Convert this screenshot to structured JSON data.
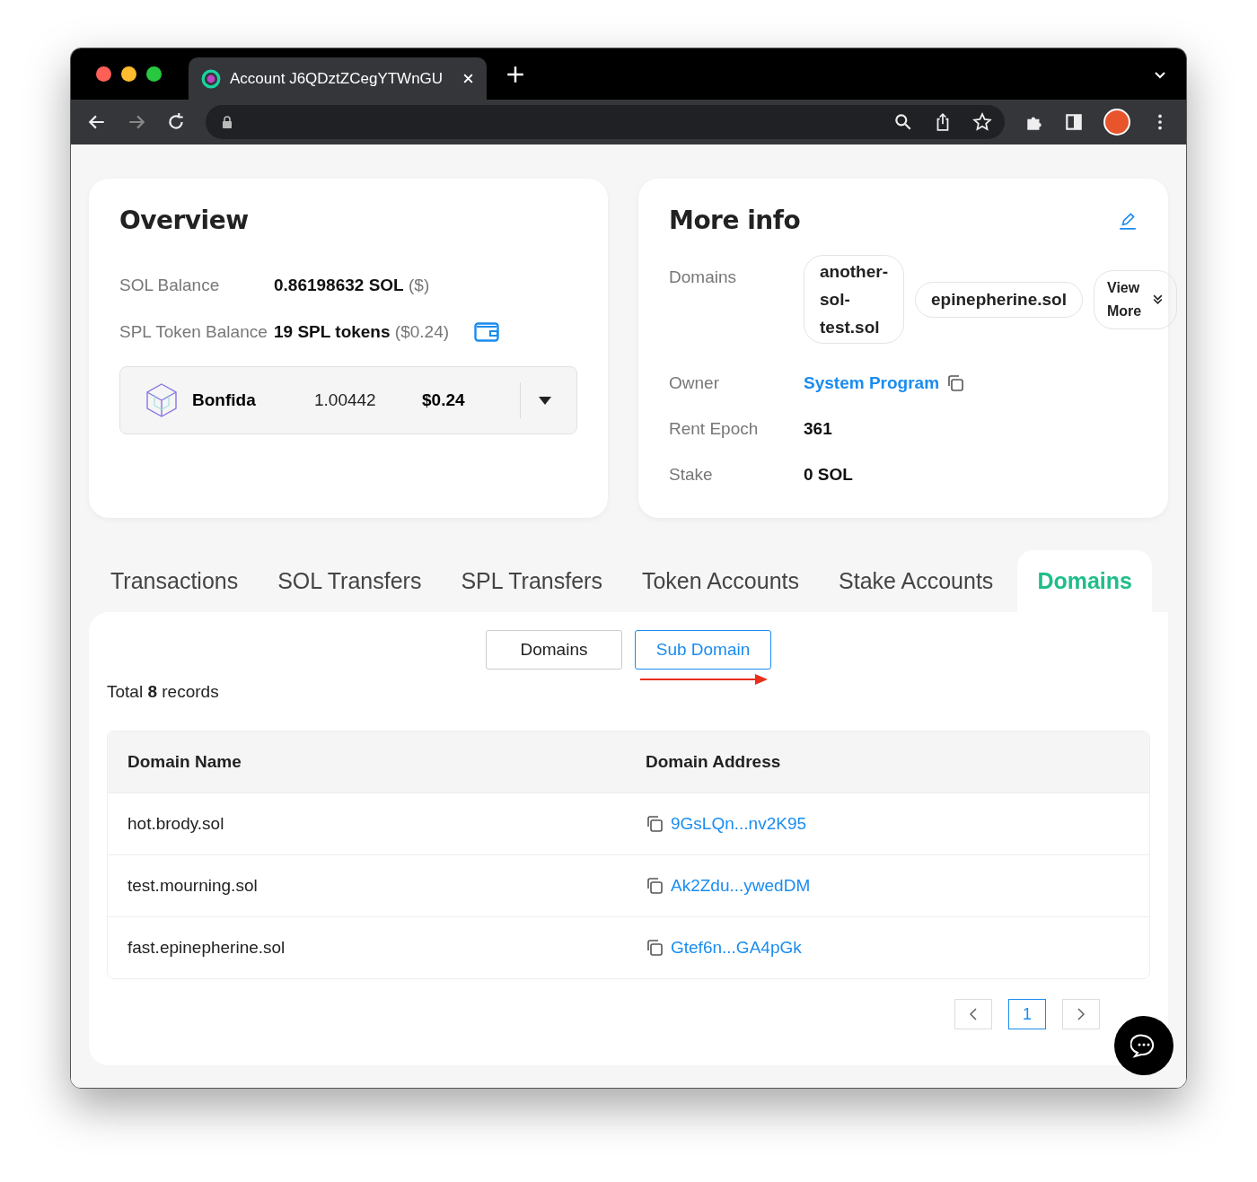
{
  "browser": {
    "tab_title": "Account J6QDztZCegYTWnGU"
  },
  "overview": {
    "title": "Overview",
    "rows": [
      {
        "label": "SOL Balance",
        "value": "0.86198632 SOL",
        "note": "($)",
        "wallet": false
      },
      {
        "label": "SPL Token Balance",
        "value": "19 SPL tokens",
        "note": "($0.24)",
        "wallet": true
      }
    ],
    "token": {
      "name": "Bonfida",
      "amount": "1.00442",
      "usd": "$0.24"
    }
  },
  "more_info": {
    "title": "More info",
    "domains_label": "Domains",
    "domains": [
      "another-sol-test.sol",
      "epinepherine.sol"
    ],
    "view_more": "View More",
    "rows": [
      {
        "label": "Owner",
        "value": "System Program",
        "kind": "link"
      },
      {
        "label": "Rent Epoch",
        "value": "361",
        "kind": "text"
      },
      {
        "label": "Stake",
        "value": "0 SOL",
        "kind": "text"
      }
    ]
  },
  "tabs": [
    {
      "label": "Transactions",
      "selected": false
    },
    {
      "label": "SOL Transfers",
      "selected": false
    },
    {
      "label": "SPL Transfers",
      "selected": false
    },
    {
      "label": "Token Accounts",
      "selected": false
    },
    {
      "label": "Stake Accounts",
      "selected": false
    },
    {
      "label": "Domains",
      "selected": true
    }
  ],
  "segments": [
    {
      "label": "Domains",
      "selected": false
    },
    {
      "label": "Sub Domain",
      "selected": true
    }
  ],
  "total": "Total **8** records",
  "table": {
    "columns": [
      "Domain Name",
      "Domain Address"
    ],
    "rows": [
      {
        "name": "hot.brody.sol",
        "address": "9GsLQn...nv2K95"
      },
      {
        "name": "test.mourning.sol",
        "address": "Ak2Zdu...ywedDM"
      },
      {
        "name": "fast.epinepherine.sol",
        "address": "Gtef6n...GA4pGk"
      }
    ]
  },
  "pagination": {
    "pages": [
      {
        "label": "1",
        "selected": true
      }
    ]
  }
}
